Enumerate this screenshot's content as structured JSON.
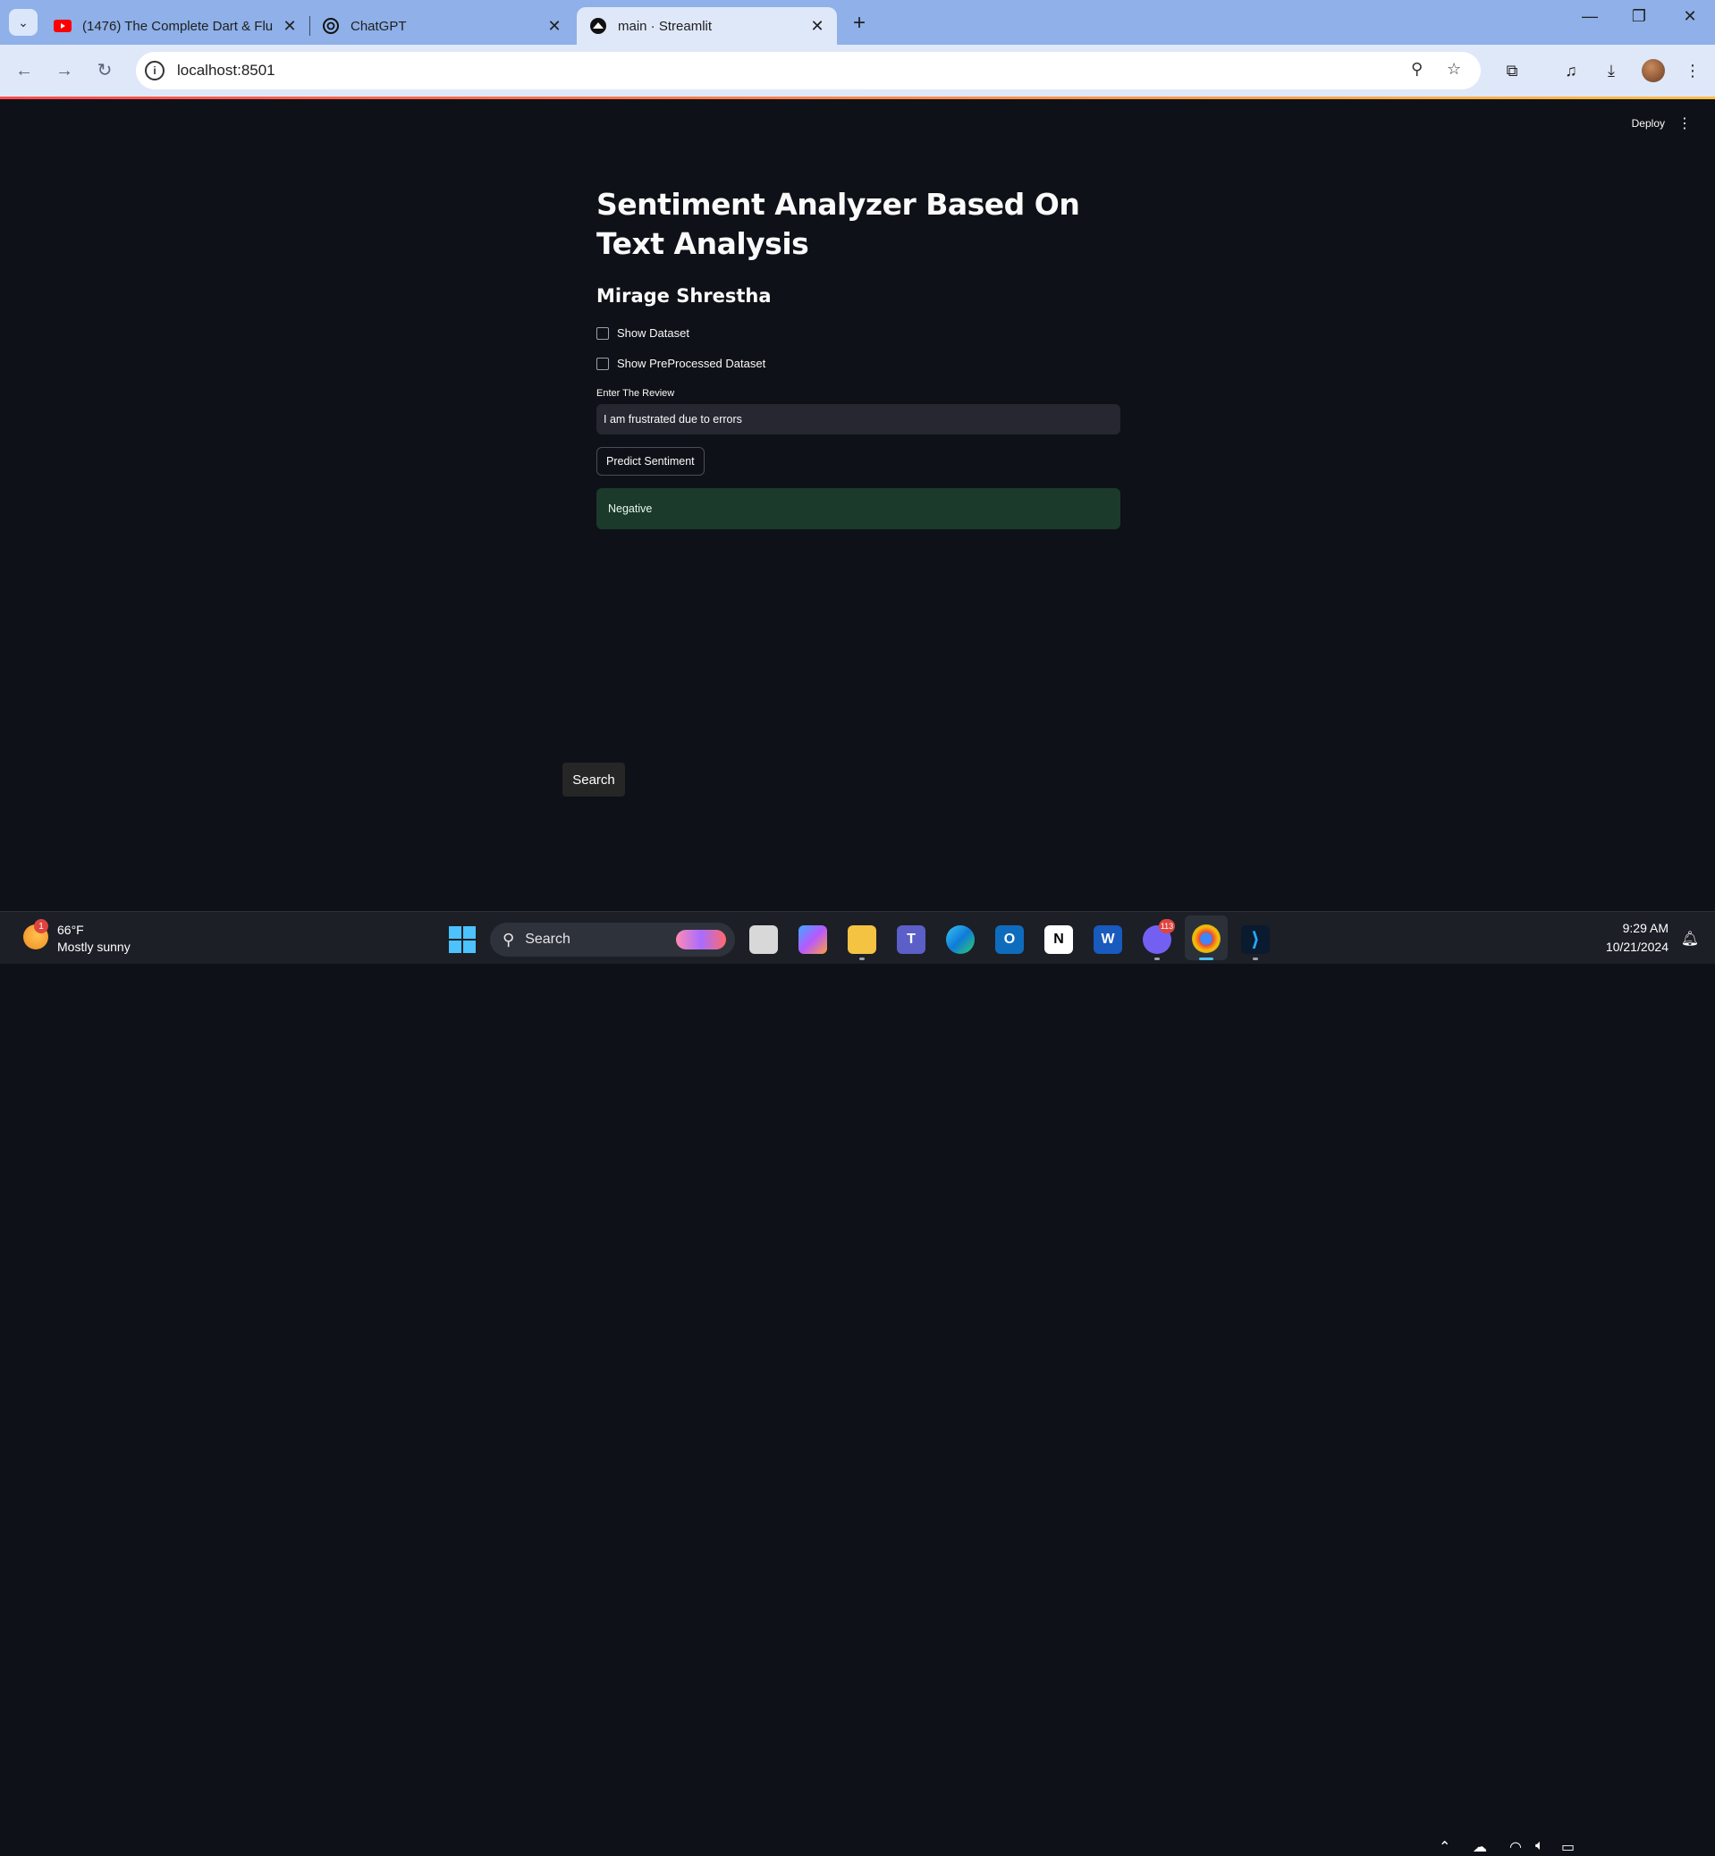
{
  "browser": {
    "tabs": [
      {
        "title": "(1476) The Complete Dart & Flu",
        "icon": "youtube-icon"
      },
      {
        "title": "ChatGPT",
        "icon": "chatgpt-icon"
      },
      {
        "title": "main · Streamlit",
        "icon": "streamlit-icon",
        "active": true
      }
    ],
    "url": "localhost:8501"
  },
  "app": {
    "deploy_label": "Deploy",
    "title": "Sentiment Analyzer Based On Text Analysis",
    "subtitle": "Mirage Shrestha",
    "checkboxes": [
      {
        "label": "Show Dataset",
        "checked": false
      },
      {
        "label": "Show PreProcessed Dataset",
        "checked": false
      }
    ],
    "review_label": "Enter The Review",
    "review_value": "I am frustrated due to errors",
    "predict_button": "Predict Sentiment",
    "result_text": "Negative",
    "accent_color": "#ff4b4b",
    "result_bg_color": "#1b3a2b"
  },
  "tooltip": {
    "text": "Search"
  },
  "taskbar": {
    "weather_temp": "66°F",
    "weather_desc": "Mostly sunny",
    "weather_badge": "1",
    "search_label": "Search",
    "viber_badge": "113",
    "clock_time": "9:29 AM",
    "clock_date": "10/21/2024"
  }
}
